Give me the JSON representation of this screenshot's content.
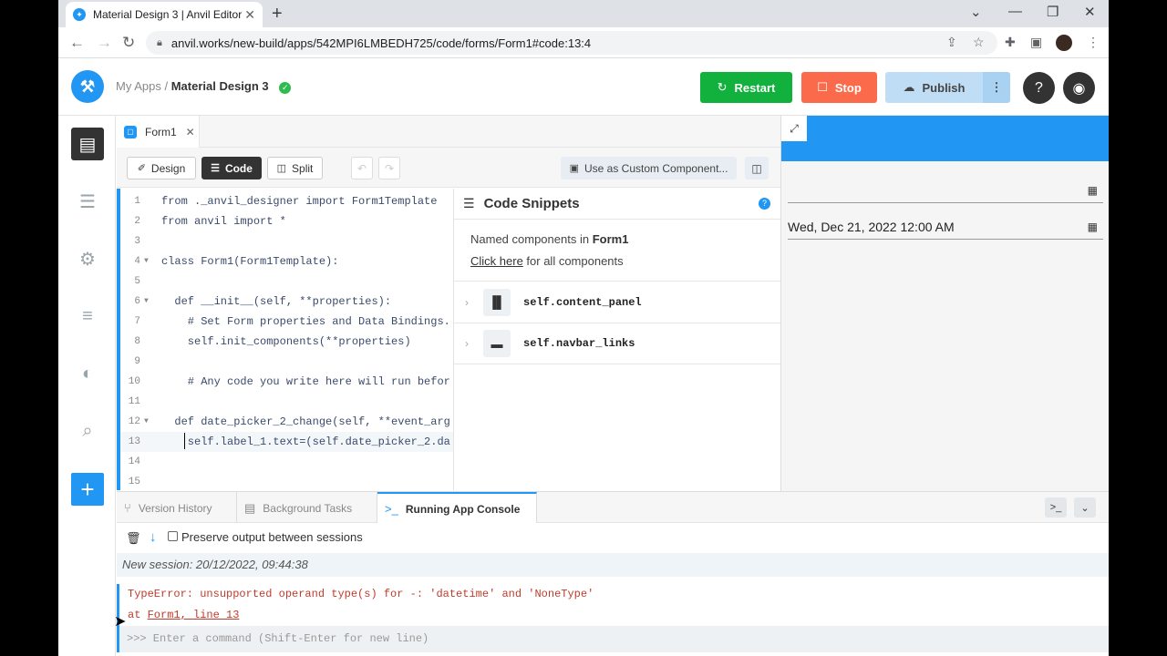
{
  "browser": {
    "tab_title": "Material Design 3 | Anvil Editor",
    "tab_close": "✕",
    "new_tab": "+",
    "url": "anvil.works/new-build/apps/542MPI6LMBEDH725/code/forms/Form1#code:13:4"
  },
  "app": {
    "breadcrumb_root": "My Apps /",
    "app_name": "Material Design 3",
    "restart_label": "Restart",
    "stop_label": "Stop",
    "publish_label": "Publish"
  },
  "editor": {
    "form_tab": "Form1",
    "form_tab_close": "✕",
    "design_label": "Design",
    "code_label": "Code",
    "split_label": "Split",
    "custom_component_label": "Use as Custom Component...",
    "code_lines": [
      {
        "num": "1",
        "text": "from ._anvil_designer import Form1Template"
      },
      {
        "num": "2",
        "text": "from anvil import *"
      },
      {
        "num": "3",
        "text": ""
      },
      {
        "num": "4",
        "text": "class Form1(Form1Template):"
      },
      {
        "num": "5",
        "text": ""
      },
      {
        "num": "6",
        "text": "  def __init__(self, **properties):"
      },
      {
        "num": "7",
        "text": "    # Set Form properties and Data Bindings."
      },
      {
        "num": "8",
        "text": "    self.init_components(**properties)"
      },
      {
        "num": "9",
        "text": ""
      },
      {
        "num": "10",
        "text": "    # Any code you write here will run befor"
      },
      {
        "num": "11",
        "text": ""
      },
      {
        "num": "12",
        "text": "  def date_picker_2_change(self, **event_arg"
      },
      {
        "num": "13",
        "text": "    self.label_1.text=(self.date_picker_2.da"
      },
      {
        "num": "14",
        "text": ""
      },
      {
        "num": "15",
        "text": ""
      }
    ]
  },
  "snippets": {
    "title": "Code Snippets",
    "named_prefix": "Named components in",
    "named_form": "Form1",
    "click_here": "Click here",
    "click_suffix": "for all components",
    "items": [
      {
        "label": "self.content_panel"
      },
      {
        "label": "self.navbar_links"
      }
    ]
  },
  "preview": {
    "date_1": "",
    "date_2": "Wed, Dec 21, 2022 12:00 AM"
  },
  "bottom": {
    "tab_version": "Version History",
    "tab_background": "Background Tasks",
    "tab_console": "Running App Console",
    "preserve_label": "Preserve output between sessions",
    "session": "New session: 20/12/2022, 09:44:38",
    "error_line1": "TypeError: unsupported operand type(s) for -: 'datetime' and 'NoneType'",
    "error_at": "at ",
    "error_loc": "Form1, line 13",
    "command_placeholder": ">>> Enter a command (Shift-Enter for new line)"
  },
  "colors": {
    "accent": "#2196f3",
    "restart": "#12b13d",
    "stop": "#fb6b4b",
    "error": "#c03b2b"
  }
}
